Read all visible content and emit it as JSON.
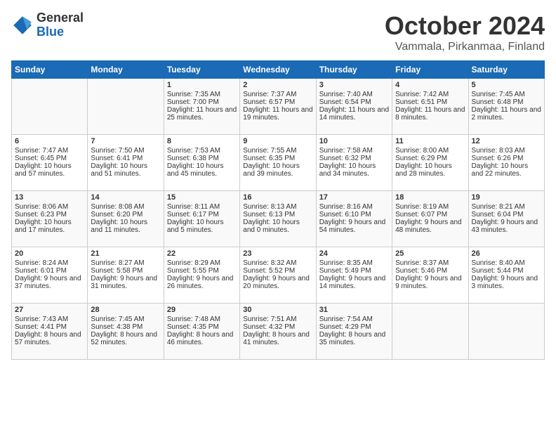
{
  "logo": {
    "general": "General",
    "blue": "Blue"
  },
  "title": "October 2024",
  "location": "Vammala, Pirkanmaa, Finland",
  "weekdays": [
    "Sunday",
    "Monday",
    "Tuesday",
    "Wednesday",
    "Thursday",
    "Friday",
    "Saturday"
  ],
  "weeks": [
    [
      {
        "day": "",
        "content": ""
      },
      {
        "day": "",
        "content": ""
      },
      {
        "day": "1",
        "content": "Sunrise: 7:35 AM\nSunset: 7:00 PM\nDaylight: 11 hours and 25 minutes."
      },
      {
        "day": "2",
        "content": "Sunrise: 7:37 AM\nSunset: 6:57 PM\nDaylight: 11 hours and 19 minutes."
      },
      {
        "day": "3",
        "content": "Sunrise: 7:40 AM\nSunset: 6:54 PM\nDaylight: 11 hours and 14 minutes."
      },
      {
        "day": "4",
        "content": "Sunrise: 7:42 AM\nSunset: 6:51 PM\nDaylight: 11 hours and 8 minutes."
      },
      {
        "day": "5",
        "content": "Sunrise: 7:45 AM\nSunset: 6:48 PM\nDaylight: 11 hours and 2 minutes."
      }
    ],
    [
      {
        "day": "6",
        "content": "Sunrise: 7:47 AM\nSunset: 6:45 PM\nDaylight: 10 hours and 57 minutes."
      },
      {
        "day": "7",
        "content": "Sunrise: 7:50 AM\nSunset: 6:41 PM\nDaylight: 10 hours and 51 minutes."
      },
      {
        "day": "8",
        "content": "Sunrise: 7:53 AM\nSunset: 6:38 PM\nDaylight: 10 hours and 45 minutes."
      },
      {
        "day": "9",
        "content": "Sunrise: 7:55 AM\nSunset: 6:35 PM\nDaylight: 10 hours and 39 minutes."
      },
      {
        "day": "10",
        "content": "Sunrise: 7:58 AM\nSunset: 6:32 PM\nDaylight: 10 hours and 34 minutes."
      },
      {
        "day": "11",
        "content": "Sunrise: 8:00 AM\nSunset: 6:29 PM\nDaylight: 10 hours and 28 minutes."
      },
      {
        "day": "12",
        "content": "Sunrise: 8:03 AM\nSunset: 6:26 PM\nDaylight: 10 hours and 22 minutes."
      }
    ],
    [
      {
        "day": "13",
        "content": "Sunrise: 8:06 AM\nSunset: 6:23 PM\nDaylight: 10 hours and 17 minutes."
      },
      {
        "day": "14",
        "content": "Sunrise: 8:08 AM\nSunset: 6:20 PM\nDaylight: 10 hours and 11 minutes."
      },
      {
        "day": "15",
        "content": "Sunrise: 8:11 AM\nSunset: 6:17 PM\nDaylight: 10 hours and 5 minutes."
      },
      {
        "day": "16",
        "content": "Sunrise: 8:13 AM\nSunset: 6:13 PM\nDaylight: 10 hours and 0 minutes."
      },
      {
        "day": "17",
        "content": "Sunrise: 8:16 AM\nSunset: 6:10 PM\nDaylight: 9 hours and 54 minutes."
      },
      {
        "day": "18",
        "content": "Sunrise: 8:19 AM\nSunset: 6:07 PM\nDaylight: 9 hours and 48 minutes."
      },
      {
        "day": "19",
        "content": "Sunrise: 8:21 AM\nSunset: 6:04 PM\nDaylight: 9 hours and 43 minutes."
      }
    ],
    [
      {
        "day": "20",
        "content": "Sunrise: 8:24 AM\nSunset: 6:01 PM\nDaylight: 9 hours and 37 minutes."
      },
      {
        "day": "21",
        "content": "Sunrise: 8:27 AM\nSunset: 5:58 PM\nDaylight: 9 hours and 31 minutes."
      },
      {
        "day": "22",
        "content": "Sunrise: 8:29 AM\nSunset: 5:55 PM\nDaylight: 9 hours and 26 minutes."
      },
      {
        "day": "23",
        "content": "Sunrise: 8:32 AM\nSunset: 5:52 PM\nDaylight: 9 hours and 20 minutes."
      },
      {
        "day": "24",
        "content": "Sunrise: 8:35 AM\nSunset: 5:49 PM\nDaylight: 9 hours and 14 minutes."
      },
      {
        "day": "25",
        "content": "Sunrise: 8:37 AM\nSunset: 5:46 PM\nDaylight: 9 hours and 9 minutes."
      },
      {
        "day": "26",
        "content": "Sunrise: 8:40 AM\nSunset: 5:44 PM\nDaylight: 9 hours and 3 minutes."
      }
    ],
    [
      {
        "day": "27",
        "content": "Sunrise: 7:43 AM\nSunset: 4:41 PM\nDaylight: 8 hours and 57 minutes."
      },
      {
        "day": "28",
        "content": "Sunrise: 7:45 AM\nSunset: 4:38 PM\nDaylight: 8 hours and 52 minutes."
      },
      {
        "day": "29",
        "content": "Sunrise: 7:48 AM\nSunset: 4:35 PM\nDaylight: 8 hours and 46 minutes."
      },
      {
        "day": "30",
        "content": "Sunrise: 7:51 AM\nSunset: 4:32 PM\nDaylight: 8 hours and 41 minutes."
      },
      {
        "day": "31",
        "content": "Sunrise: 7:54 AM\nSunset: 4:29 PM\nDaylight: 8 hours and 35 minutes."
      },
      {
        "day": "",
        "content": ""
      },
      {
        "day": "",
        "content": ""
      }
    ]
  ]
}
